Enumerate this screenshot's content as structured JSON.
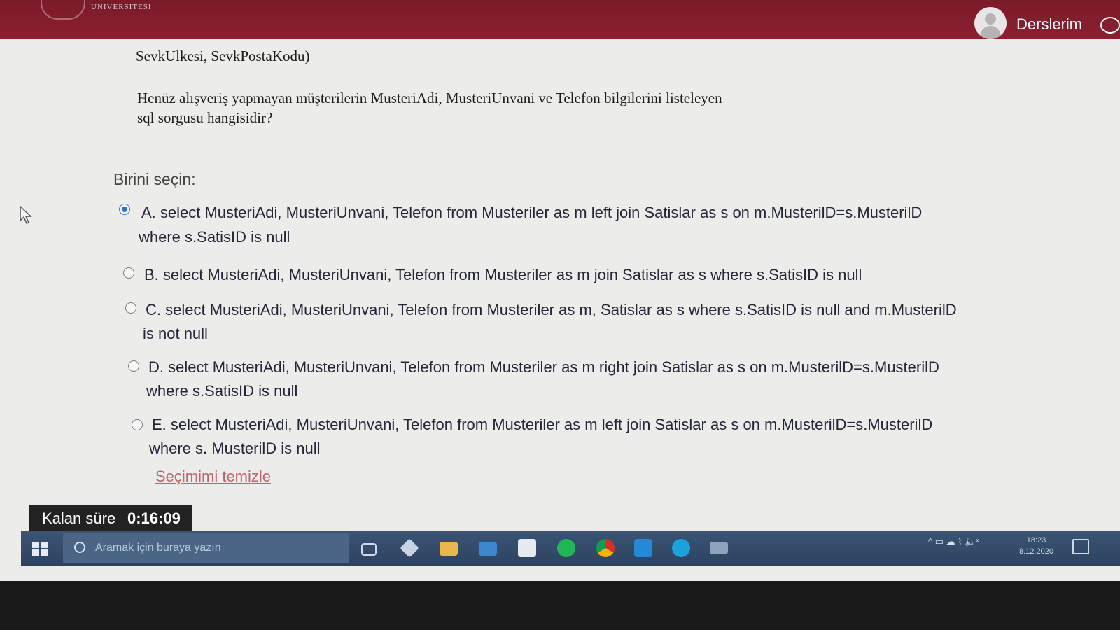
{
  "header": {
    "university_text": "UNIVERSITESI",
    "courses_label": "Derslerim",
    "chat_icon": "chat-bubble-icon",
    "avatar_icon": "user-avatar-icon"
  },
  "question": {
    "previous_line": "SevkUlkesi, SevkPostaKodu)",
    "line1": "Henüz alışveriş yapmayan müşterilerin MusteriAdi, MusteriUnvani ve Telefon bilgilerini listeleyen",
    "line2": "sql sorgusu hangisidir?"
  },
  "choose_label": "Birini seçin:",
  "options": [
    {
      "line1": "A. select MusteriAdi, MusteriUnvani, Telefon from Musteriler as m left join Satislar as s on m.MusterilD=s.MusterilD",
      "line2": "where s.SatisID is null",
      "selected": true
    },
    {
      "line1": "B. select MusteriAdi, MusteriUnvani, Telefon from Musteriler as m join Satislar as s where s.SatisID is null",
      "line2": "",
      "selected": false
    },
    {
      "line1": "C. select MusteriAdi, MusteriUnvani, Telefon from Musteriler as m, Satislar as s where s.SatisID is null and m.MusterilD",
      "line2": "is not null",
      "selected": false
    },
    {
      "line1": "D. select MusteriAdi, MusteriUnvani, Telefon from Musteriler as m right join Satislar as s on m.MusterilD=s.MusterilD",
      "line2": "where s.SatisID is null",
      "selected": false
    },
    {
      "line1": "E. select MusteriAdi, MusteriUnvani, Telefon from Musteriler as m left join Satislar as s on m.MusterilD=s.MusterilD",
      "line2": "where s. MusterilD is null",
      "selected": false
    }
  ],
  "clear_selection": "Seçimimi temizle",
  "timer": {
    "label": "Kalan süre",
    "value": "0:16:09"
  },
  "taskbar": {
    "search_placeholder": "Aramak için buraya yazın",
    "tray_symbols": "^ ▭ ☁ ⌇ 🔈ˣ",
    "clock_time": "18:23",
    "clock_date": "8.12.2020"
  },
  "colors": {
    "header_maroon": "#8c1f30",
    "link_red": "#c06466",
    "radio_blue": "#2f6fd1",
    "taskbar_blue": "#2c4260"
  }
}
